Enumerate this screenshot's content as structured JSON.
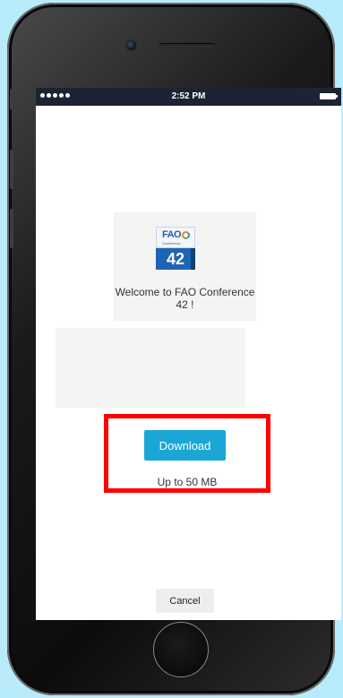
{
  "status_bar": {
    "time": "2:52 PM",
    "signal_dots": 5
  },
  "app_card": {
    "logo": {
      "top_text": "FAO",
      "sub_text": "Conference",
      "number": "42"
    },
    "welcome_text": "Welcome to FAO Conference 42 !"
  },
  "download": {
    "button_label": "Download",
    "size_text": "Up to 50 MB"
  },
  "cancel_label": "Cancel",
  "colors": {
    "background": "#b9ecfb",
    "download_button": "#1ba7d6",
    "highlight_border": "#ff0000",
    "status_bar": "#1c2433"
  }
}
